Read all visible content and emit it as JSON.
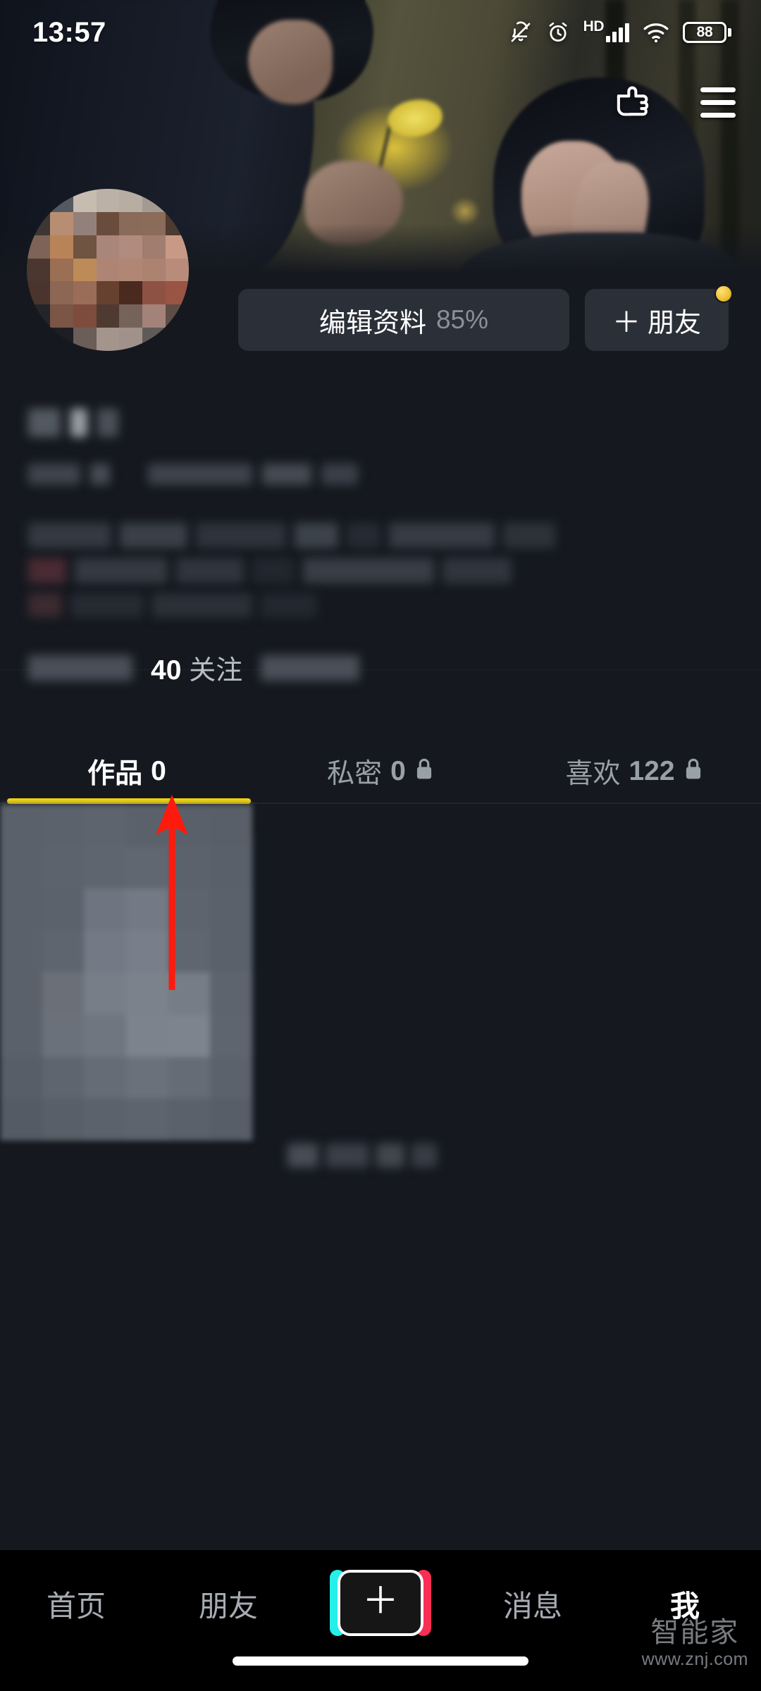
{
  "status_bar": {
    "time": "13:57",
    "icons": [
      "bell-muted-icon",
      "alarm-clock-icon",
      "hd-icon",
      "signal-bars-icon",
      "wifi-icon",
      "battery-icon"
    ],
    "hd_label": "HD",
    "battery_level": "88"
  },
  "header": {
    "pointer_icon": "pointing-hand-icon",
    "menu_icon": "hamburger-menu-icon"
  },
  "profile": {
    "avatar": "user-avatar-pixelated",
    "edit_button": {
      "label": "编辑资料",
      "percent": "85%"
    },
    "friend_button": {
      "plus": "＋",
      "label": "朋友",
      "badge": "coin-badge"
    },
    "username": "[blurred]",
    "user_id": "[blurred]",
    "bio": "[blurred]",
    "stats": [
      {
        "count": "[blurred]",
        "label": "",
        "name": "followers-stat"
      },
      {
        "count": "40",
        "label": "关注",
        "name": "following-stat"
      },
      {
        "count": "[blurred]",
        "label": "",
        "name": "likes-stat"
      }
    ]
  },
  "tabs": [
    {
      "label": "作品",
      "count": "0",
      "locked": false,
      "active": true
    },
    {
      "label": "私密",
      "count": "0",
      "locked": true,
      "active": false
    },
    {
      "label": "喜欢",
      "count": "122",
      "locked": true,
      "active": false
    }
  ],
  "content": {
    "card": "video-thumbnail-pixelated",
    "caption": "[blurred]"
  },
  "annotation": {
    "type": "red-arrow-up",
    "color": "#fe1a0d",
    "points_at": "40 关注"
  },
  "bottom_nav": [
    {
      "label": "首页",
      "active": false,
      "name": "nav-home"
    },
    {
      "label": "朋友",
      "active": false,
      "name": "nav-friends"
    },
    {
      "label": "＋",
      "active": false,
      "name": "nav-create"
    },
    {
      "label": "消息",
      "active": false,
      "name": "nav-messages"
    },
    {
      "label": "我",
      "active": true,
      "name": "nav-me"
    }
  ],
  "watermark": {
    "brand": "智能家",
    "url": "www.znj.com"
  },
  "colors": {
    "accent_yellow": "#f5d70a",
    "annotation_red": "#fe1a0d",
    "bg_dark": "#15181f",
    "pill_bg": "#2b2f38",
    "nav_bg": "#000000"
  }
}
